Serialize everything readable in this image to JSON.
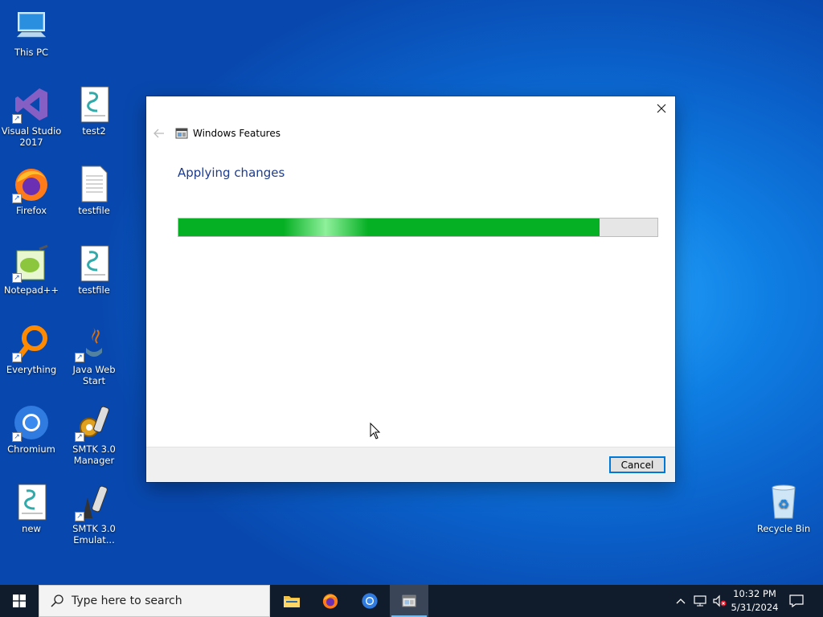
{
  "desktop": {
    "icons": [
      {
        "label": "This PC"
      },
      {
        "label": "Visual Studio 2017"
      },
      {
        "label": "test2"
      },
      {
        "label": "Firefox"
      },
      {
        "label": "testfile"
      },
      {
        "label": "Notepad++"
      },
      {
        "label": "testfile"
      },
      {
        "label": "Everything"
      },
      {
        "label": "Java Web Start"
      },
      {
        "label": "Chromium"
      },
      {
        "label": "SMTK 3.0 Manager"
      },
      {
        "label": "new"
      },
      {
        "label": "SMTK 3.0 Emulat..."
      },
      {
        "label": "Recycle Bin"
      }
    ]
  },
  "dialog": {
    "title": "Windows Features",
    "heading": "Applying changes",
    "progress_fraction": 0.88,
    "cancel_label": "Cancel"
  },
  "taskbar": {
    "search_placeholder": "Type here to search",
    "time": "10:32 PM",
    "date": "5/31/2024"
  },
  "colors": {
    "progress_green": "#06b025",
    "heading_blue": "#1e3c8c",
    "taskbar": "#101b2b",
    "focus_border": "#0078d7"
  }
}
